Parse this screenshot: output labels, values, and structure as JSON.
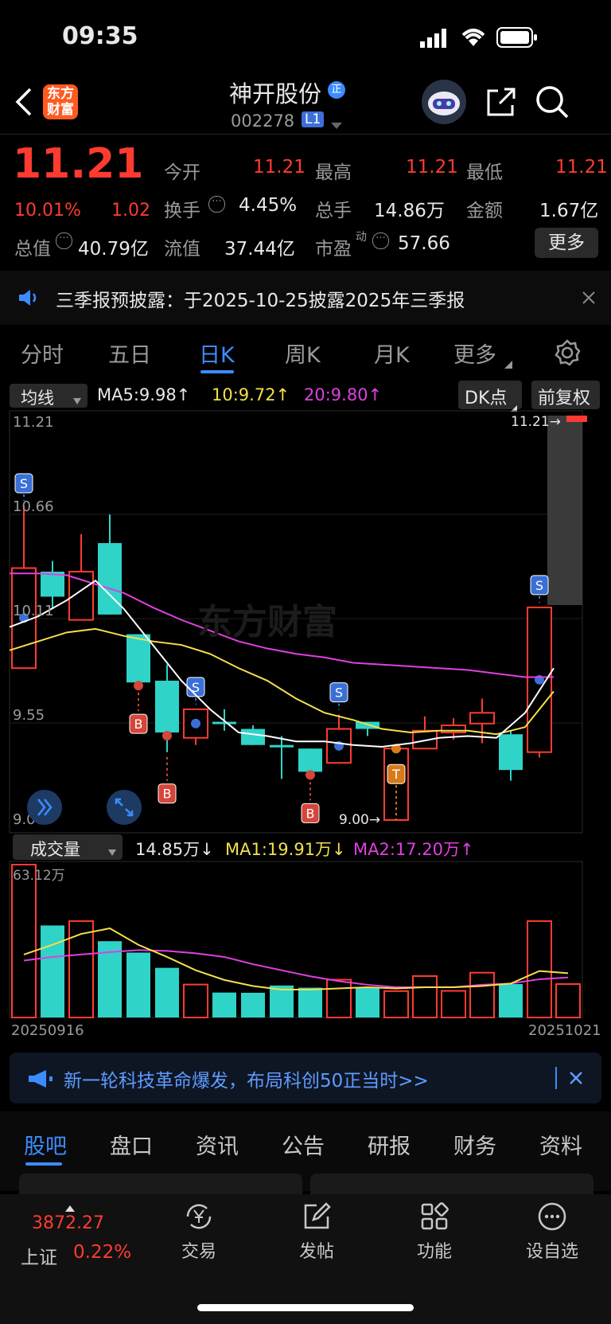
{
  "status": {
    "time": "09:35"
  },
  "header": {
    "logo_line1": "东方",
    "logo_line2": "财富",
    "stock_name": "神开股份",
    "badge_zheng": "正",
    "stock_code": "002278",
    "level_badge": "L1"
  },
  "quote": {
    "price": "11.21",
    "change_pct": "10.01%",
    "change_abs": "1.02",
    "open_label": "今开",
    "open": "11.21",
    "high_label": "最高",
    "high": "11.21",
    "low_label": "最低",
    "low": "11.21",
    "turnover_label": "换手",
    "turnover": "4.45%",
    "volume_label": "总手",
    "volume": "14.86万",
    "amount_label": "金额",
    "amount": "1.67亿",
    "mktcap_label": "总值",
    "mktcap": "40.79亿",
    "float_label": "流值",
    "float_cap": "37.44亿",
    "pe_label": "市盈",
    "pe_sup": "动",
    "pe": "57.66",
    "more_button": "更多"
  },
  "notice": {
    "text": "三季报预披露：于2025-10-25披露2025年三季报"
  },
  "chart_tabs": [
    {
      "label": "分时"
    },
    {
      "label": "五日"
    },
    {
      "label": "日K"
    },
    {
      "label": "周K"
    },
    {
      "label": "月K"
    },
    {
      "label": "更多"
    }
  ],
  "ma_bar": {
    "selector": "均线",
    "ma5": "MA5:9.98↑",
    "ma10": "10:9.72↑",
    "ma20": "20:9.80↑",
    "dk_button": "DK点",
    "adjust_button": "前复权"
  },
  "kline_labels": {
    "top": "11.21",
    "l2": "10.66",
    "l3": "10.11",
    "l4": "9.55",
    "bottom": "9.00",
    "max_marker": "11.21→",
    "min_marker": "9.00→",
    "watermark": "东方财富"
  },
  "volume_bar": {
    "selector": "成交量",
    "vol": "14.85万↓",
    "ma1": "MA1:19.91万↓",
    "ma2": "MA2:17.20万↑",
    "max_label": "63.12万",
    "start_date": "20250916",
    "end_date": "20251021"
  },
  "promo": {
    "text": "新一轮科技革命爆发，布局科创50正当时>>"
  },
  "section_tabs": [
    {
      "label": "股吧"
    },
    {
      "label": "盘口"
    },
    {
      "label": "资讯"
    },
    {
      "label": "公告"
    },
    {
      "label": "研报"
    },
    {
      "label": "财务"
    },
    {
      "label": "资料"
    }
  ],
  "bottom_nav": {
    "index_value": "3872.27",
    "index_name": "上证",
    "index_pct": "0.22%",
    "trade": "交易",
    "post": "发帖",
    "func": "功能",
    "watch": "设自选"
  },
  "colors": {
    "up": "#ff3b30",
    "down": "#2fd3c8",
    "accent": "#3d8cff",
    "ma5": "#ffffff",
    "ma10": "#f5e04a",
    "ma20": "#e040e0"
  },
  "chart_data": {
    "type": "candlestick",
    "price_range": [
      9.0,
      11.21
    ],
    "candles": [
      {
        "o": 9.85,
        "c": 10.41,
        "h": 10.76,
        "l": 9.85,
        "up": true,
        "sig": "S"
      },
      {
        "o": 10.39,
        "c": 10.25,
        "h": 10.45,
        "l": 10.18,
        "up": false
      },
      {
        "o": 10.12,
        "c": 10.39,
        "h": 10.6,
        "l": 10.12,
        "up": true
      },
      {
        "o": 10.55,
        "c": 10.15,
        "h": 10.71,
        "l": 10.15,
        "up": false
      },
      {
        "o": 10.04,
        "c": 9.77,
        "h": 10.04,
        "l": 9.77,
        "up": false,
        "sig": "B"
      },
      {
        "o": 9.78,
        "c": 9.49,
        "h": 9.87,
        "l": 9.38,
        "up": false,
        "sig": "B"
      },
      {
        "o": 9.46,
        "c": 9.62,
        "h": 9.62,
        "l": 9.42,
        "up": true,
        "sig": "S"
      },
      {
        "o": 9.55,
        "c": 9.55,
        "h": 9.62,
        "l": 9.5,
        "up": false
      },
      {
        "o": 9.51,
        "c": 9.42,
        "h": 9.53,
        "l": 9.42,
        "up": false
      },
      {
        "o": 9.42,
        "c": 9.42,
        "h": 9.47,
        "l": 9.23,
        "up": false
      },
      {
        "o": 9.4,
        "c": 9.27,
        "h": 9.4,
        "l": 9.27,
        "up": false,
        "sig": "B"
      },
      {
        "o": 9.32,
        "c": 9.51,
        "h": 9.59,
        "l": 9.32,
        "up": true,
        "sig": "S"
      },
      {
        "o": 9.51,
        "c": 9.55,
        "h": 9.55,
        "l": 9.47,
        "up": false
      },
      {
        "o": 9.0,
        "c": 9.4,
        "h": 9.4,
        "l": 9.0,
        "up": true,
        "sig": "T"
      },
      {
        "o": 9.4,
        "c": 9.5,
        "h": 9.58,
        "l": 9.4,
        "up": true
      },
      {
        "o": 9.49,
        "c": 9.53,
        "h": 9.57,
        "l": 9.45,
        "up": true
      },
      {
        "o": 9.54,
        "c": 9.6,
        "h": 9.68,
        "l": 9.43,
        "up": true
      },
      {
        "o": 9.48,
        "c": 9.28,
        "h": 9.5,
        "l": 9.22,
        "up": false
      },
      {
        "o": 9.38,
        "c": 10.19,
        "h": 10.19,
        "l": 9.35,
        "up": true,
        "sig": "S"
      }
    ],
    "ma5": [
      10.08,
      10.14,
      10.23,
      10.34,
      10.18,
      9.98,
      9.78,
      9.62,
      9.49,
      9.47,
      9.44,
      9.44,
      9.42,
      9.41,
      9.43,
      9.46,
      9.47,
      9.46,
      9.6,
      9.85
    ],
    "ma10": [
      9.95,
      10.0,
      10.05,
      10.07,
      10.03,
      10.0,
      9.98,
      9.93,
      9.85,
      9.78,
      9.68,
      9.6,
      9.56,
      9.51,
      9.49,
      9.5,
      9.5,
      9.48,
      9.52,
      9.72
    ],
    "ma20": [
      10.38,
      10.38,
      10.37,
      10.32,
      10.27,
      10.19,
      10.12,
      10.06,
      10.0,
      9.96,
      9.93,
      9.91,
      9.88,
      9.87,
      9.86,
      9.85,
      9.84,
      9.82,
      9.8,
      9.8
    ],
    "volume_max": 63.12,
    "volumes": [
      63.12,
      38.0,
      39.8,
      31.5,
      26.8,
      20.5,
      13.6,
      10.3,
      10.2,
      13.2,
      12.3,
      15.6,
      12.6,
      10.9,
      17.1,
      11.0,
      18.5,
      13.8,
      39.8,
      13.8
    ],
    "volume_ma1": [
      26.0,
      30.0,
      34.5,
      36.8,
      30.0,
      25.0,
      19.5,
      15.5,
      13.0,
      11.5,
      11.5,
      12.0,
      12.5,
      12.0,
      12.5,
      12.5,
      13.0,
      14.0,
      19.2,
      18.3
    ],
    "volume_ma2": [
      23.5,
      25.0,
      26.0,
      27.0,
      27.8,
      27.5,
      26.5,
      25.0,
      22.0,
      19.5,
      17.0,
      15.0,
      13.5,
      12.5,
      12.5,
      12.5,
      13.5,
      14.0,
      15.8,
      16.5
    ]
  }
}
